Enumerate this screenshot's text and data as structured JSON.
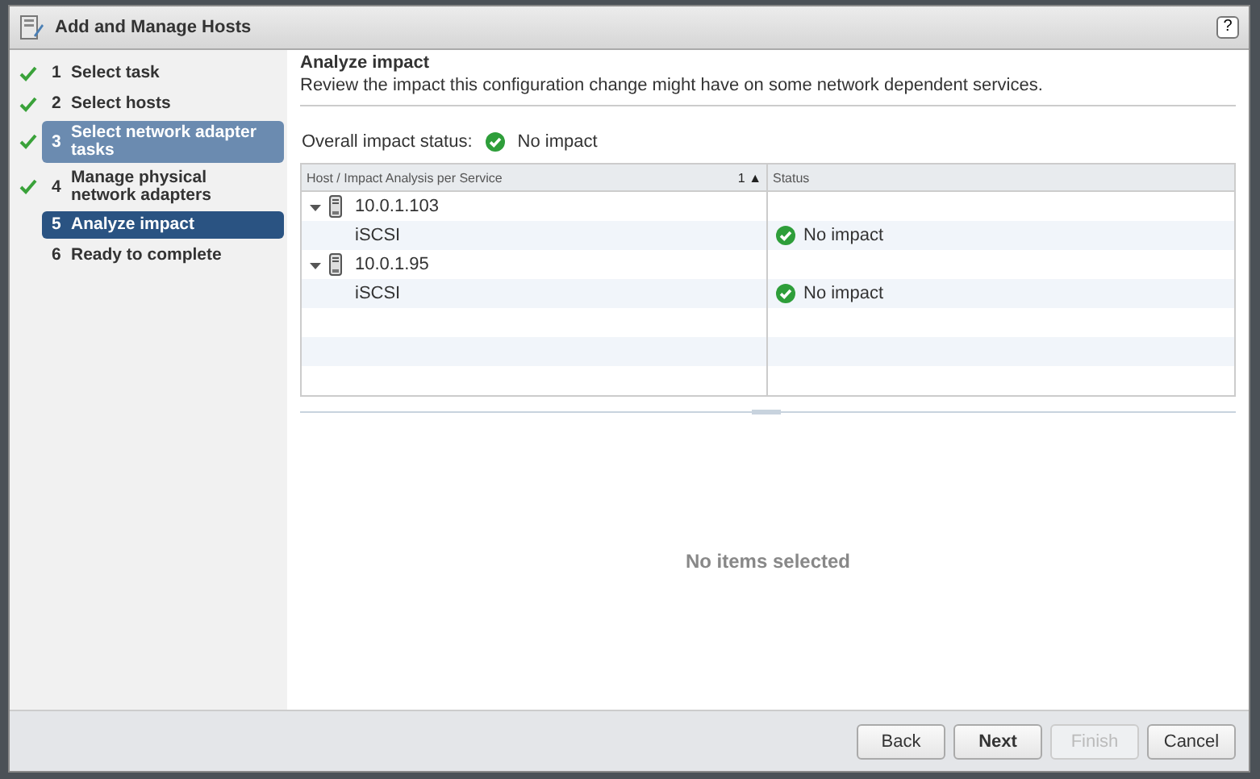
{
  "window": {
    "title": "Add and Manage Hosts",
    "help": "?"
  },
  "steps": [
    {
      "number": "1",
      "label": "Select task",
      "done": true,
      "selected": false,
      "highlighted": false
    },
    {
      "number": "2",
      "label": "Select hosts",
      "done": true,
      "selected": false,
      "highlighted": false
    },
    {
      "number": "3",
      "label": "Select network adapter tasks",
      "done": true,
      "selected": false,
      "highlighted": true
    },
    {
      "number": "4",
      "label": "Manage physical network adapters",
      "done": true,
      "selected": false,
      "highlighted": false
    },
    {
      "number": "5",
      "label": "Analyze impact",
      "done": false,
      "selected": true,
      "highlighted": false
    },
    {
      "number": "6",
      "label": "Ready to complete",
      "done": false,
      "selected": false,
      "highlighted": false
    }
  ],
  "page": {
    "title": "Analyze impact",
    "description": "Review the impact this configuration change might have on some network dependent services."
  },
  "overall": {
    "label": "Overall impact status:",
    "value": "No impact"
  },
  "table": {
    "columns": [
      {
        "label": "Host / Impact Analysis per Service",
        "sort": "1 ▲"
      },
      {
        "label": "Status"
      }
    ],
    "rows": [
      {
        "kind": "host",
        "name": "10.0.1.103",
        "expanded": true,
        "children": [
          {
            "kind": "service",
            "name": "iSCSI",
            "status": "No impact"
          }
        ]
      },
      {
        "kind": "host",
        "name": "10.0.1.95",
        "expanded": true,
        "children": [
          {
            "kind": "service",
            "name": "iSCSI",
            "status": "No impact"
          }
        ]
      }
    ]
  },
  "details": {
    "empty_text": "No items selected"
  },
  "buttons": [
    {
      "label": "Back",
      "disabled": false,
      "primary": false
    },
    {
      "label": "Next",
      "disabled": false,
      "primary": true
    },
    {
      "label": "Finish",
      "disabled": true,
      "primary": false
    },
    {
      "label": "Cancel",
      "disabled": false,
      "primary": false
    }
  ]
}
